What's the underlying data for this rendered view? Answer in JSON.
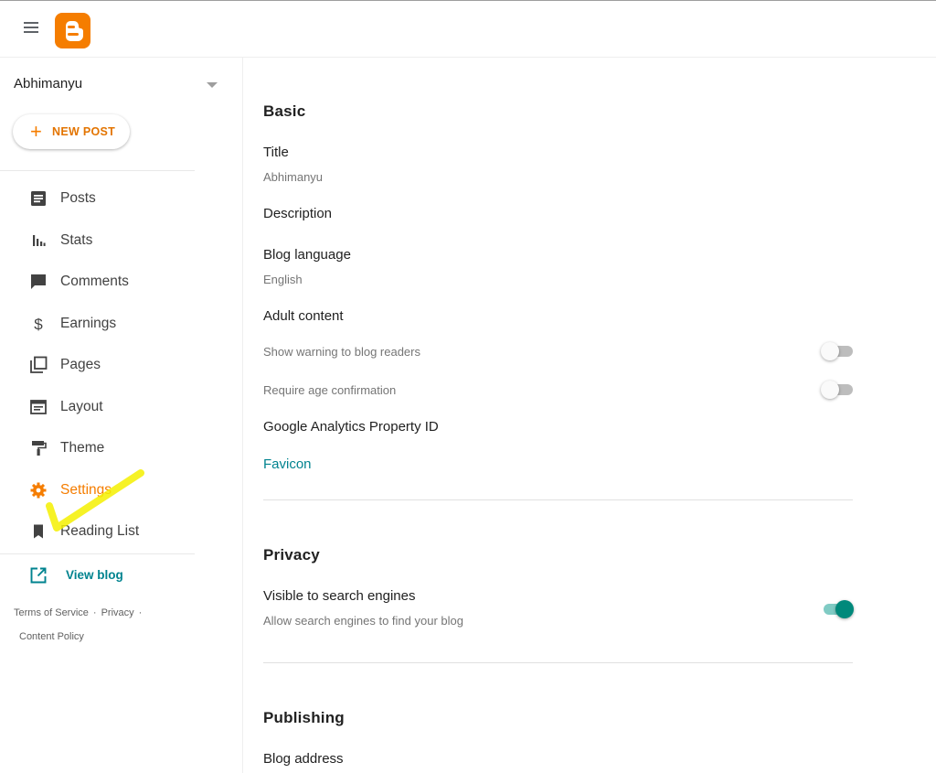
{
  "header": {
    "menu_icon": "hamburger-menu-icon",
    "logo_icon": "blogger-logo-icon"
  },
  "sidebar": {
    "blog_name": "Abhimanyu",
    "new_post_label": "NEW POST",
    "items": [
      {
        "label": "Posts",
        "icon": "posts-icon"
      },
      {
        "label": "Stats",
        "icon": "stats-icon"
      },
      {
        "label": "Comments",
        "icon": "comment-icon"
      },
      {
        "label": "Earnings",
        "icon": "dollar-icon"
      },
      {
        "label": "Pages",
        "icon": "pages-icon"
      },
      {
        "label": "Layout",
        "icon": "layout-icon"
      },
      {
        "label": "Theme",
        "icon": "paint-roller-icon"
      },
      {
        "label": "Settings",
        "icon": "gear-icon",
        "active": true
      },
      {
        "label": "Reading List",
        "icon": "bookmark-icon"
      }
    ],
    "view_blog_label": "View blog",
    "footer": {
      "terms": "Terms of Service",
      "privacy": "Privacy",
      "content_policy": "Content Policy"
    }
  },
  "main": {
    "basic": {
      "title": "Basic",
      "title_label": "Title",
      "title_value": "Abhimanyu",
      "description_label": "Description",
      "language_label": "Blog language",
      "language_value": "English",
      "adult_label": "Adult content",
      "warning_label": "Show warning to blog readers",
      "warning_on": false,
      "age_label": "Require age confirmation",
      "age_on": false,
      "analytics_label": "Google Analytics Property ID",
      "favicon_label": "Favicon"
    },
    "privacy": {
      "title": "Privacy",
      "visible_label": "Visible to search engines",
      "visible_sub": "Allow search engines to find your blog",
      "visible_on": true
    },
    "publishing": {
      "title": "Publishing",
      "address_label": "Blog address"
    }
  },
  "colors": {
    "accent": "#f57d00",
    "link": "#00838f",
    "toggle_on": "#00897b",
    "highlight_mark": "#f5f000"
  }
}
